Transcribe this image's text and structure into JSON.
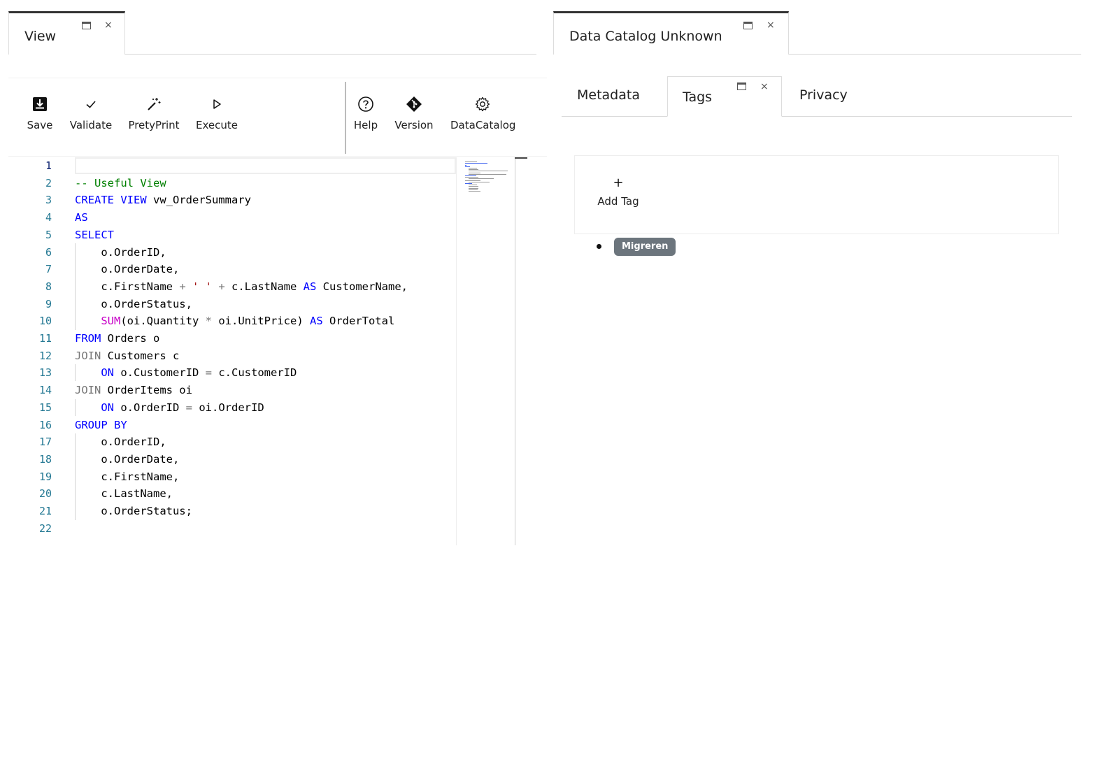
{
  "left_pane": {
    "tab": {
      "label": "View",
      "window_icon": "window-icon",
      "close_symbol": "×"
    },
    "toolbar": {
      "buttons": [
        {
          "label": "Save",
          "icon": "save-icon"
        },
        {
          "label": "Validate",
          "icon": "check-icon"
        },
        {
          "label": "PretyPrint",
          "icon": "magic-wand-icon"
        },
        {
          "label": "Execute",
          "icon": "play-icon"
        },
        {
          "label": "Help",
          "icon": "help-icon"
        },
        {
          "label": "Version",
          "icon": "git-icon"
        },
        {
          "label": "DataCatalog",
          "icon": "gear-icon"
        }
      ]
    },
    "editor": {
      "active_line": 1,
      "line_numbers": [
        "1",
        "2",
        "3",
        "4",
        "5",
        "6",
        "7",
        "8",
        "9",
        "10",
        "11",
        "12",
        "13",
        "14",
        "15",
        "16",
        "17",
        "18",
        "19",
        "20",
        "21",
        "22"
      ],
      "lines": [
        [],
        [
          {
            "t": "-- Useful View",
            "c": "cm"
          }
        ],
        [
          {
            "t": "CREATE VIEW",
            "c": "kw"
          },
          {
            "t": " vw_OrderSummary"
          }
        ],
        [
          {
            "t": "AS",
            "c": "kw"
          }
        ],
        [
          {
            "t": "SELECT",
            "c": "kw"
          }
        ],
        [
          {
            "t": "    o.OrderID,"
          }
        ],
        [
          {
            "t": "    o.OrderDate,"
          }
        ],
        [
          {
            "t": "    c.FirstName "
          },
          {
            "t": "+",
            "c": "op"
          },
          {
            "t": " "
          },
          {
            "t": "' '",
            "c": "st"
          },
          {
            "t": " "
          },
          {
            "t": "+",
            "c": "op"
          },
          {
            "t": " c.LastName "
          },
          {
            "t": "AS",
            "c": "kw"
          },
          {
            "t": " CustomerName,"
          }
        ],
        [
          {
            "t": "    o.OrderStatus,"
          }
        ],
        [
          {
            "t": "    "
          },
          {
            "t": "SUM",
            "c": "fn"
          },
          {
            "t": "(oi.Quantity "
          },
          {
            "t": "*",
            "c": "op"
          },
          {
            "t": " oi.UnitPrice) "
          },
          {
            "t": "AS",
            "c": "kw"
          },
          {
            "t": " OrderTotal"
          }
        ],
        [
          {
            "t": "FROM",
            "c": "kw"
          },
          {
            "t": " Orders o"
          }
        ],
        [
          {
            "t": "JOIN",
            "c": "jn"
          },
          {
            "t": " Customers c"
          }
        ],
        [
          {
            "t": "    "
          },
          {
            "t": "ON",
            "c": "kw"
          },
          {
            "t": " o.CustomerID "
          },
          {
            "t": "=",
            "c": "op"
          },
          {
            "t": " c.CustomerID"
          }
        ],
        [
          {
            "t": "JOIN",
            "c": "jn"
          },
          {
            "t": " OrderItems oi"
          }
        ],
        [
          {
            "t": "    "
          },
          {
            "t": "ON",
            "c": "kw"
          },
          {
            "t": " o.OrderID "
          },
          {
            "t": "=",
            "c": "op"
          },
          {
            "t": " oi.OrderID"
          }
        ],
        [
          {
            "t": "GROUP BY",
            "c": "kw"
          }
        ],
        [
          {
            "t": "    o.OrderID,"
          }
        ],
        [
          {
            "t": "    o.OrderDate,"
          }
        ],
        [
          {
            "t": "    c.FirstName,"
          }
        ],
        [
          {
            "t": "    c.LastName,"
          }
        ],
        [
          {
            "t": "    o.OrderStatus;"
          }
        ],
        []
      ]
    }
  },
  "right_pane": {
    "tab": {
      "label": "Data Catalog Unknown",
      "window_icon": "window-icon",
      "close_symbol": "×"
    },
    "subtabs": [
      {
        "label": "Metadata",
        "active": false
      },
      {
        "label": "Tags",
        "active": true
      },
      {
        "label": "Privacy",
        "active": false
      }
    ],
    "add_tag": {
      "symbol": "+",
      "label": "Add Tag"
    },
    "tags": [
      "Migreren"
    ]
  },
  "colors": {
    "keyword": "#0000ff",
    "comment": "#008000",
    "string": "#a31515",
    "function": "#c700c7",
    "line_number": "#237893",
    "badge": "#6c757d"
  }
}
